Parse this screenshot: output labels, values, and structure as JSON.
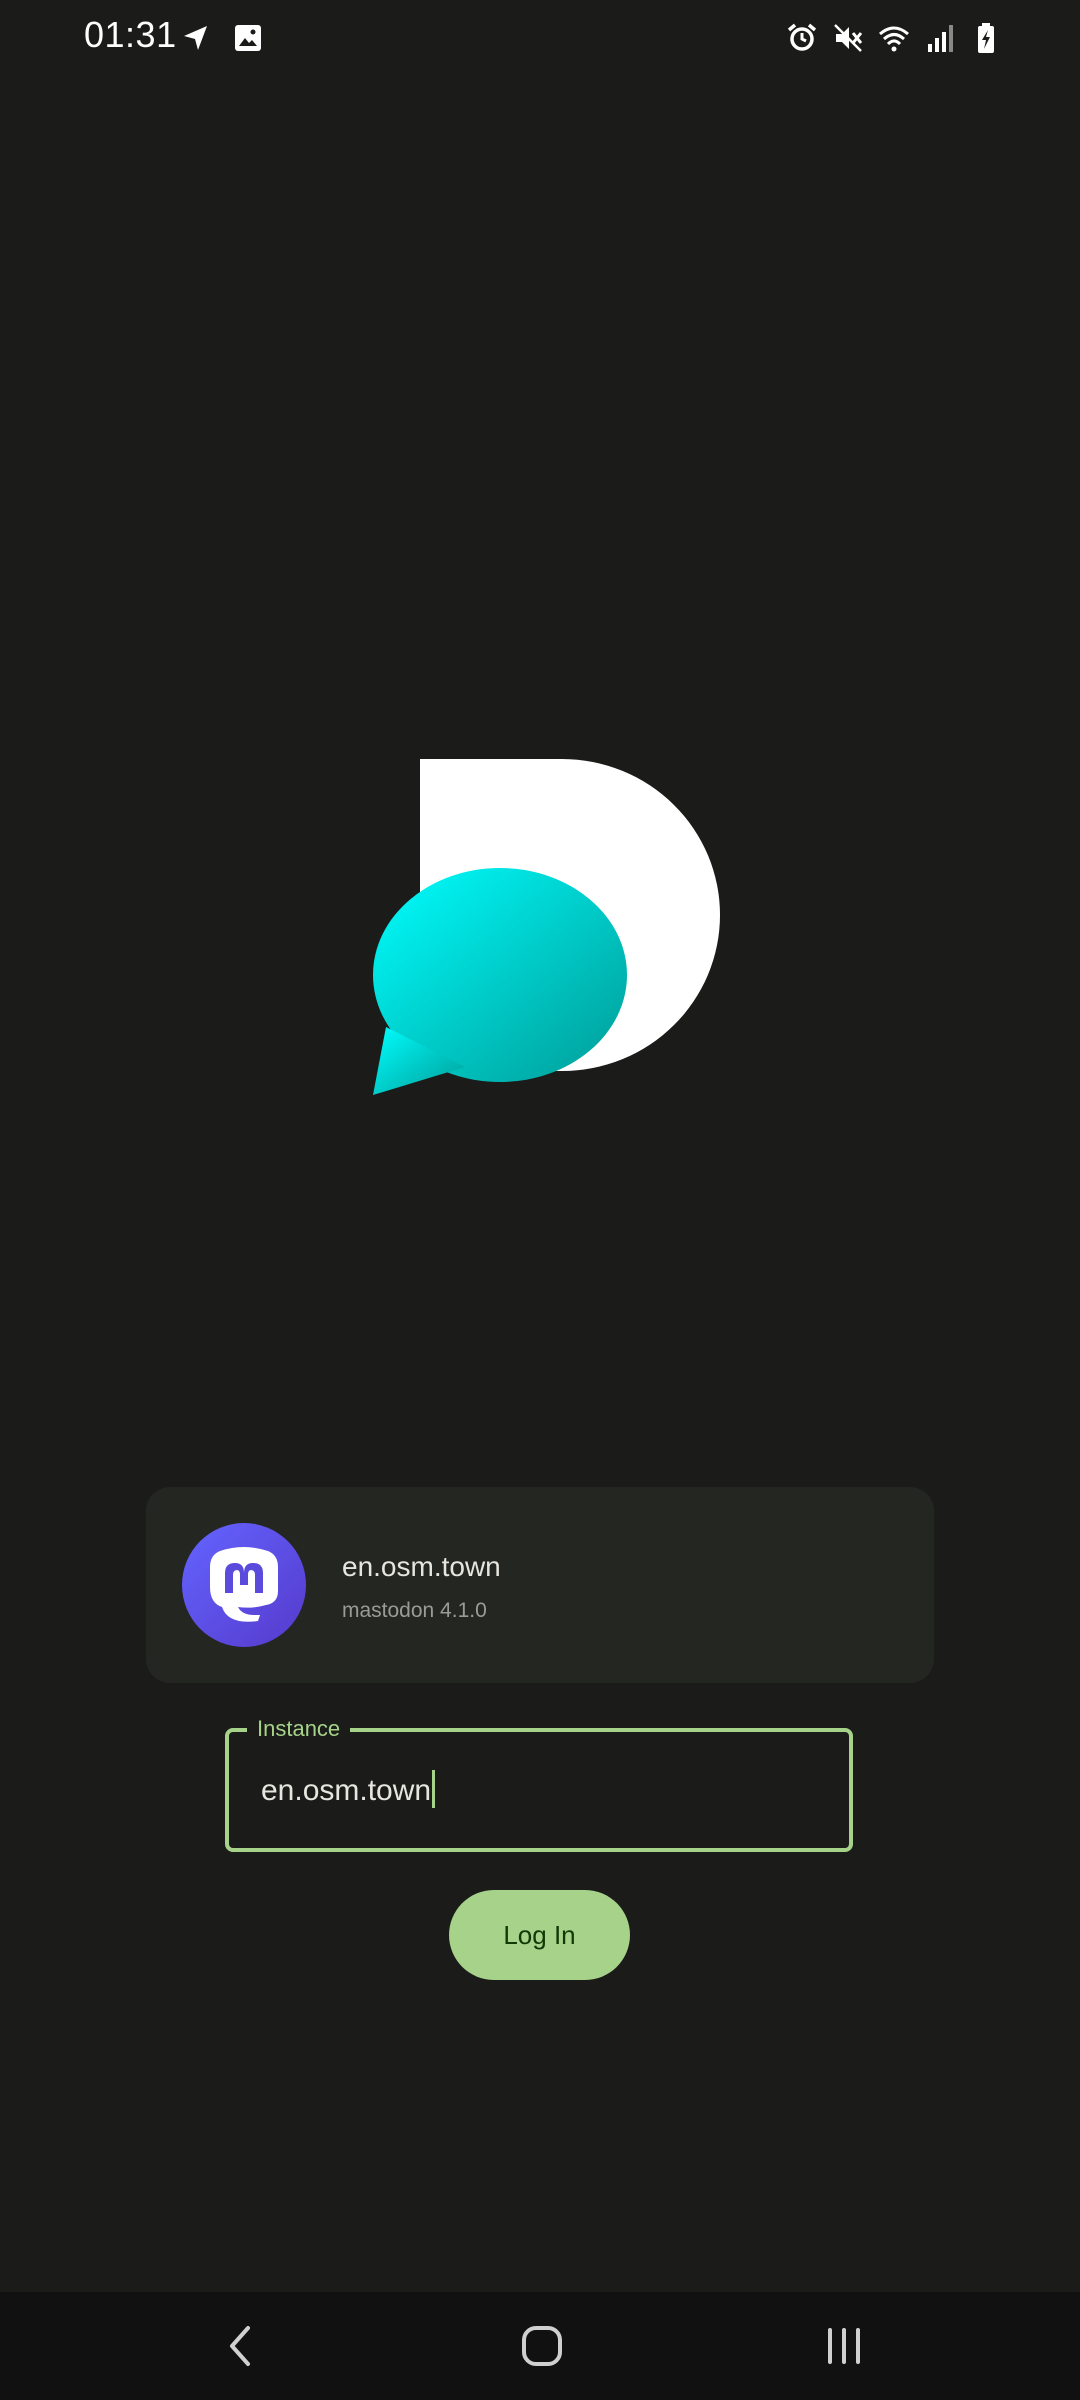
{
  "status_bar": {
    "time": "01:31",
    "left_icons": [
      "navigation-arrow-icon",
      "image-icon"
    ],
    "right_icons": [
      "alarm-icon",
      "mute-icon",
      "wifi-icon",
      "signal-icon",
      "battery-charging-icon"
    ]
  },
  "instance_card": {
    "name": "en.osm.town",
    "version": "mastodon 4.1.0",
    "avatar_icon": "mastodon-logo-icon"
  },
  "instance_field": {
    "label": "Instance",
    "value": "en.osm.town"
  },
  "login_button": {
    "label": "Log In"
  },
  "nav_bar": {
    "icons": [
      "back-icon",
      "home-icon",
      "recents-icon"
    ]
  },
  "colors": {
    "background": "#1b1c19",
    "accent": "#a6d28a",
    "card": "#242622",
    "mastodon_purple": "#6364ff",
    "logo_teal": "#00c2c2"
  }
}
